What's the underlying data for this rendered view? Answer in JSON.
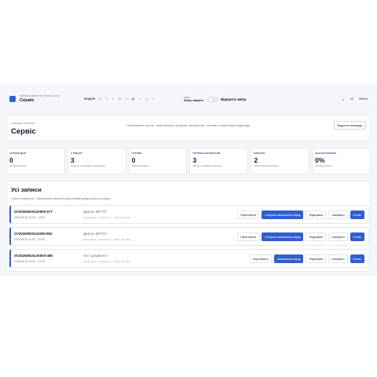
{
  "header": {
    "breadcrumb": "BUSINESS DIRECTOR / РОБОЧА ЗОНА",
    "app_title": "Сервіс",
    "modules_label": "МОДУЛІ",
    "modules": [
      "О",
      "П",
      "≡",
      "⊞",
      "≡",
      "▦",
      "≡",
      "◎",
      "≡"
    ],
    "shift_small": "ЗМІНА",
    "shift_status": "Зміну закрито",
    "open_shift": "Відкрити зміну",
    "theme_icon": "moon-icon",
    "lang": "UK",
    "exit": "Вийти"
  },
  "title_card": {
    "crumb": "КАЛЕНДАР І РЕСУРСИ",
    "title": "Сервіс",
    "intro": "Планування послуг, який запису, ресурсів, матеріалів і зв’язків з робочими модулями.",
    "open_calendar": "Відкрити календар"
  },
  "stats": [
    {
      "label": "ЗАПИСИ ДНЯ",
      "value": "0",
      "desc": "За обраним днем"
    },
    {
      "label": "У РОБОТІ",
      "value": "3",
      "desc": "Чернетки, заплановані, підтверджені"
    },
    {
      "label": "ГОТОВО",
      "value": "0",
      "desc": "Завершені записи"
    },
    {
      "label": "ПОТРІБНІ МАТЕРІАЛИ",
      "value": "3",
      "desc": "Записи з позиціями матеріалів"
    },
    {
      "label": "КЛІЄНТИ",
      "value": "2",
      "desc": "Унікальні контакти сервісу"
    },
    {
      "label": "ЗАВАНТАЖЕННЯ",
      "value": "0%",
      "desc": "За обраним днем"
    }
  ],
  "records": {
    "title": "Усі записи",
    "description": "Список створених і збережених записів з доступними діями робочого циклу.",
    "rows": [
      {
        "id": "SV20260816120000-577",
        "time": "2026-08-16 12:00 – 13:00",
        "name": "Дмитро МЕТУС",
        "meta": "Заплановано · Матеріали: 1 · Разом: 400.0000",
        "actions": [
          "Переглянути",
          "Створити замовлення-наряд",
          "Редагувати",
          "Скасувати",
          "Готово"
        ]
      },
      {
        "id": "SV20260816110000-853",
        "time": "2026-08-16 11:00 – 12:00",
        "name": "Дмитро МЕТУС",
        "meta": "Заплановано · Матеріали: 1 · Разом: 400.0000",
        "actions": [
          "Переглянути",
          "Створити замовлення-наряд",
          "Редагувати",
          "Скасувати",
          "Готово"
        ]
      },
      {
        "id": "SV20260815130000-388",
        "time": "2026-08-15 13:00 – 14:00",
        "name": "Тест документа",
        "meta": "Заплановано · Матеріали: 1 · Разом: 300.0000",
        "actions": [
          "Переглянути",
          "Замовлення-наряд",
          "Редагувати",
          "Скасувати",
          "Готово"
        ]
      }
    ]
  },
  "colors": {
    "accent": "#2f5fd0",
    "background": "#f4f6fa",
    "card": "#ffffff"
  }
}
